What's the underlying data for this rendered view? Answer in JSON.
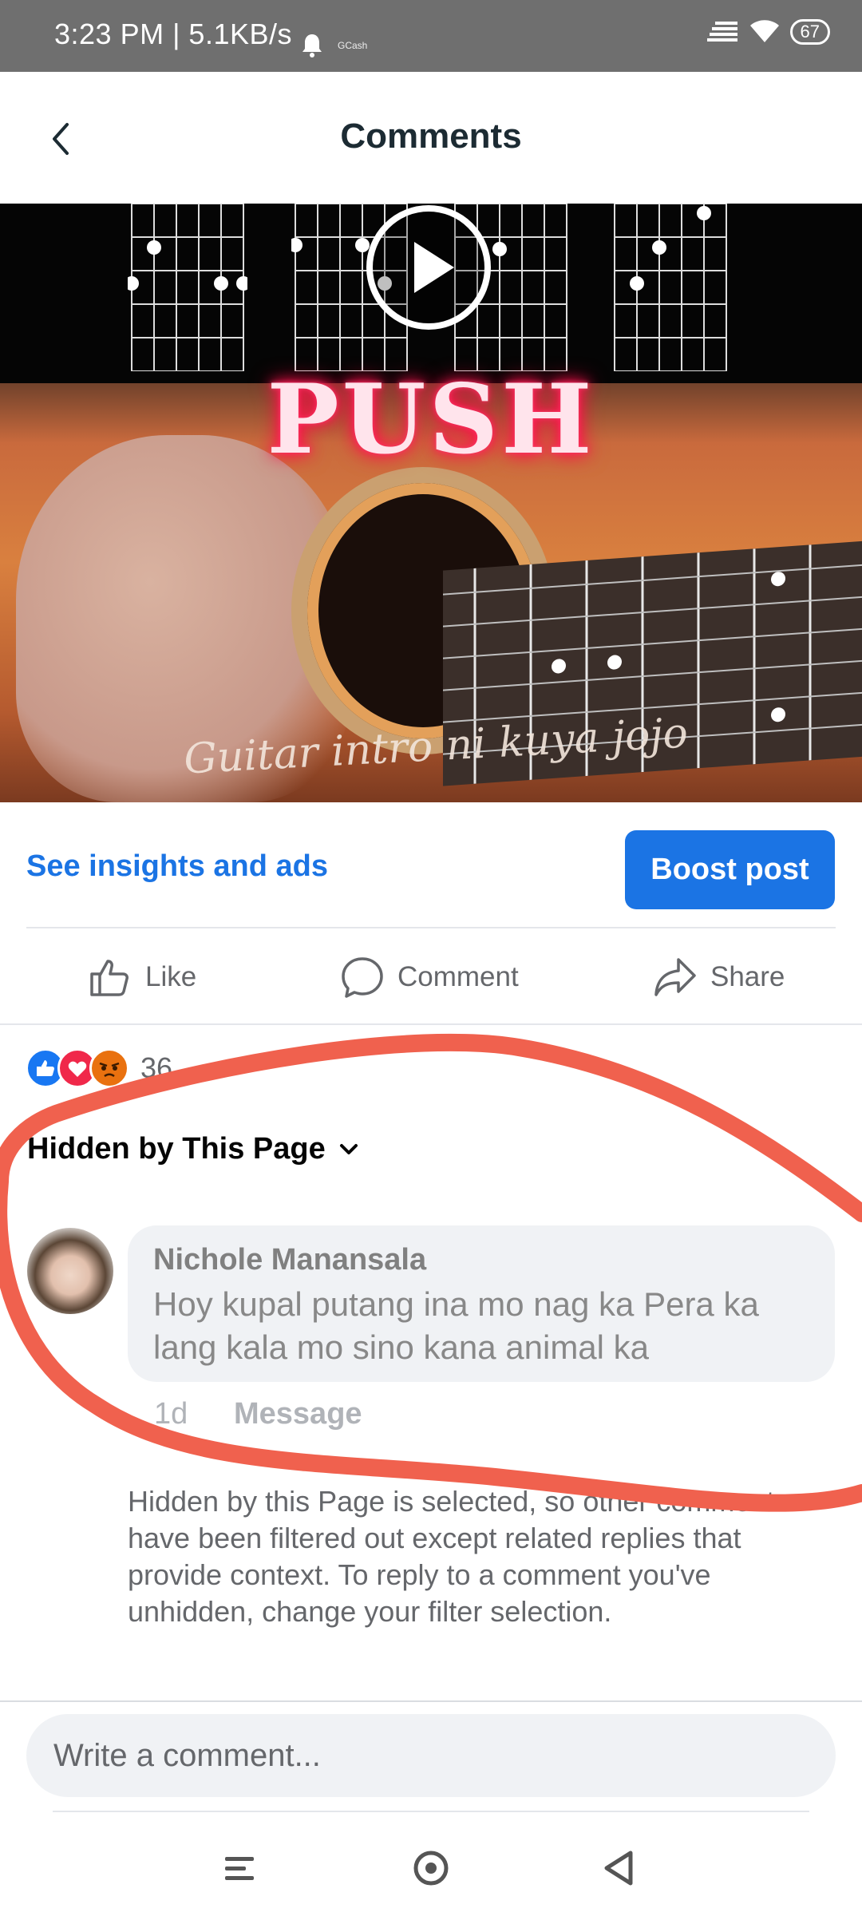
{
  "status_bar": {
    "time": "3:23 PM | 5.1KB/s",
    "gcash_label": "GCash",
    "battery": "67"
  },
  "header": {
    "title": "Comments"
  },
  "media": {
    "overlay_text": "PUSH",
    "caption": "Guitar intro ni kuya jojo"
  },
  "insights": {
    "link_label": "See insights and ads",
    "boost_label": "Boost post"
  },
  "actions": {
    "like_label": "Like",
    "comment_label": "Comment",
    "share_label": "Share"
  },
  "reactions": {
    "count": "36",
    "colors": {
      "like": "#1877f2",
      "love": "#f0284a",
      "angry": "#e9710f"
    }
  },
  "filter": {
    "label": "Hidden by This Page"
  },
  "comment": {
    "author": "Nichole Manansala",
    "text": "Hoy kupal putang ina mo nag ka Pera ka lang kala mo sino kana animal ka",
    "time": "1d",
    "message_label": "Message"
  },
  "info": {
    "text": "Hidden by this Page is selected, so other comments have been filtered out except related replies that provide context. To reply to a comment you've unhidden, change your filter selection."
  },
  "composer": {
    "placeholder": "Write a comment..."
  },
  "colors": {
    "accent": "#1b74e4",
    "annotation": "#f0614e"
  }
}
